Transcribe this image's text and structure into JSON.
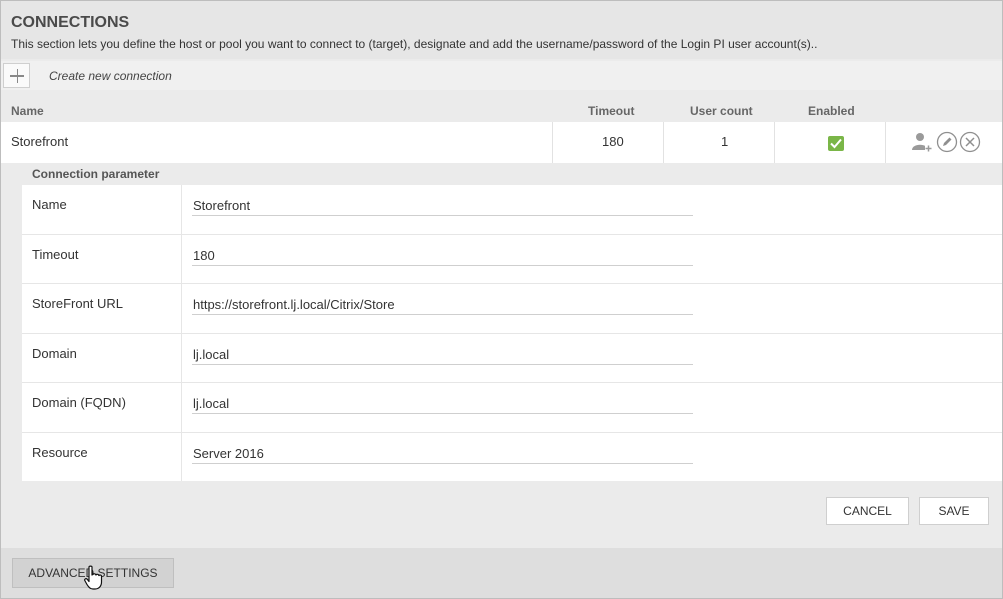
{
  "header": {
    "title": "CONNECTIONS",
    "description": "This section lets you define the host or pool you want to connect to (target), designate and add the username/password of the Login PI user account(s).."
  },
  "toolbar": {
    "add_icon": "plus-icon",
    "create_label": "Create new connection"
  },
  "table": {
    "columns": [
      "Name",
      "Timeout",
      "User count",
      "Enabled"
    ],
    "rows": [
      {
        "name": "Storefront",
        "timeout": "180",
        "user_count": "1",
        "enabled": true,
        "actions": [
          "add-user-icon",
          "edit-pencil-icon",
          "delete-x-icon"
        ]
      }
    ]
  },
  "connection_parameter": {
    "title": "Connection parameter",
    "fields": [
      {
        "label": "Name",
        "value": "Storefront"
      },
      {
        "label": "Timeout",
        "value": "180"
      },
      {
        "label": "StoreFront URL",
        "value": "https://storefront.lj.local/Citrix/Store"
      },
      {
        "label": "Domain",
        "value": "lj.local"
      },
      {
        "label": "Domain (FQDN)",
        "value": "lj.local"
      },
      {
        "label": "Resource",
        "value": "Server 2016"
      }
    ]
  },
  "buttons": {
    "cancel": "CANCEL",
    "save": "SAVE",
    "advanced_settings": "ADVANCED SETTINGS"
  },
  "colors": {
    "enabled_check": "#7ab648",
    "background": "#ebebeb"
  }
}
